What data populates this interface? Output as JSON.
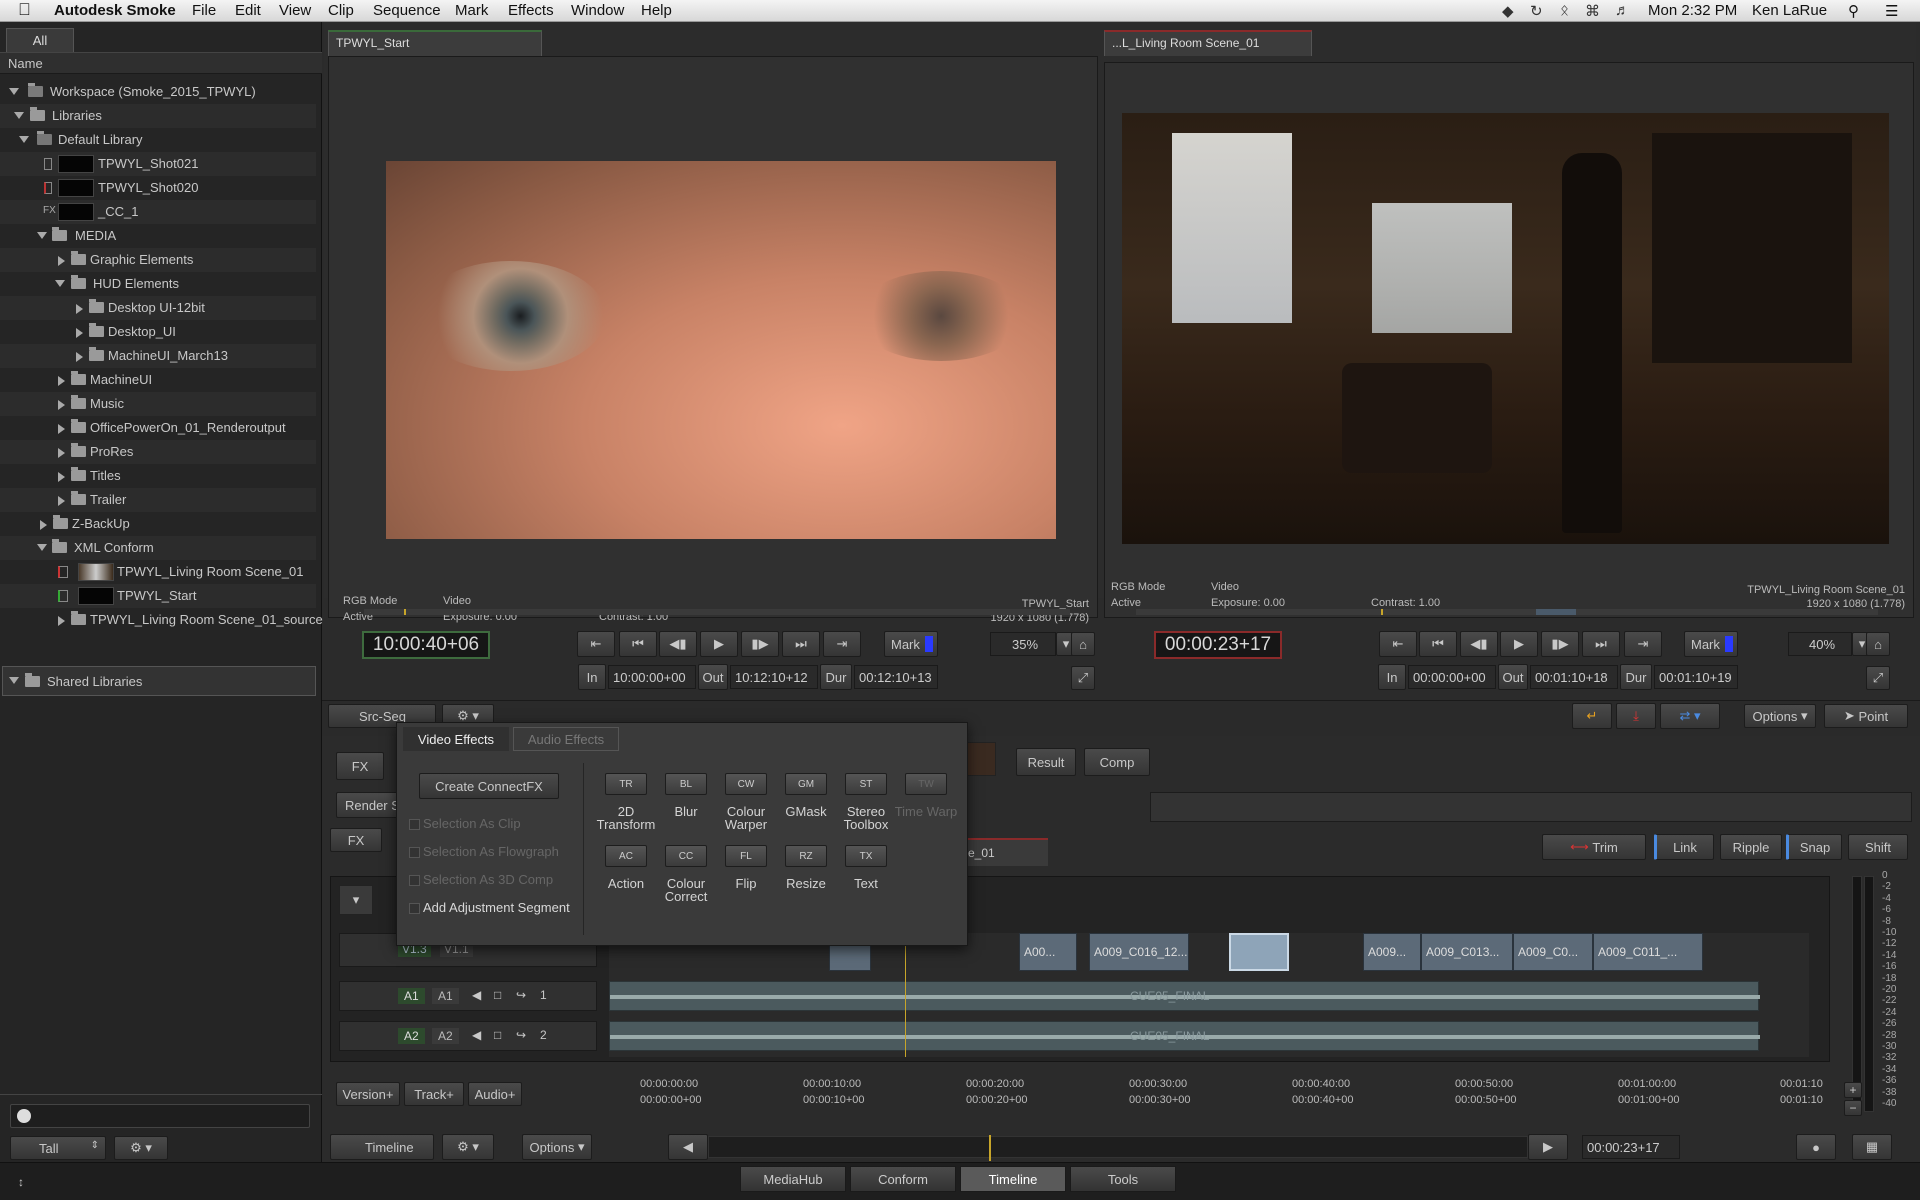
{
  "menubar": {
    "app_name": "Autodesk Smoke",
    "items": [
      "File",
      "Edit",
      "View",
      "Clip",
      "Sequence",
      "Mark",
      "Effects",
      "Window",
      "Help"
    ],
    "clock": "Mon 2:32 PM",
    "user": "Ken LaRue"
  },
  "sidebar": {
    "tab_all": "All",
    "column_name": "Name",
    "tree": {
      "workspace": "Workspace (Smoke_2015_TPWYL)",
      "libraries": "Libraries",
      "default_library": "Default Library",
      "shot021": "TPWYL_Shot021",
      "shot020": "TPWYL_Shot020",
      "cc1": "_CC_1",
      "fx_tag": "FX",
      "media": "MEDIA",
      "graphic_elements": "Graphic Elements",
      "hud_elements": "HUD Elements",
      "desktop_ui_12bit": "Desktop UI-12bit",
      "desktop_ui": "Desktop_UI",
      "machineui_march13": "MachineUI_March13",
      "machineui": "MachineUI",
      "music": "Music",
      "officepoweron": "OfficePowerOn_01_Renderoutput",
      "prores": "ProRes",
      "titles": "Titles",
      "trailer": "Trailer",
      "zbackup": "Z-BackUp",
      "xml_conform": "XML Conform",
      "living_room": "TPWYL_Living Room Scene_01",
      "tpwyl_start": "TPWYL_Start",
      "living_room_source": "TPWYL_Living Room Scene_01_source"
    },
    "shared_libraries": "Shared Libraries",
    "view_mode": "Tall"
  },
  "left_viewer": {
    "tab": "TPWYL_Start",
    "rgb_mode": "RGB Mode",
    "active": "Active",
    "video": "Video",
    "exposure": "Exposure: 0.00",
    "contrast": "Contrast: 1.00",
    "clip_name": "TPWYL_Start",
    "resolution": "1920 x 1080 (1.778)",
    "timecode": "10:00:40+06",
    "mark": "Mark",
    "zoom": "35%",
    "in_label": "In",
    "in_value": "10:00:00+00",
    "out_label": "Out",
    "out_value": "10:12:10+12",
    "dur_label": "Dur",
    "dur_value": "00:12:10+13"
  },
  "right_viewer": {
    "tab": "...L_Living Room Scene_01",
    "rgb_mode": "RGB Mode",
    "active": "Active",
    "video": "Video",
    "exposure": "Exposure: 0.00",
    "contrast": "Contrast: 1.00",
    "clip_name": "TPWYL_Living Room Scene_01",
    "resolution": "1920 x 1080 (1.778)",
    "timecode": "00:00:23+17",
    "mark": "Mark",
    "zoom": "40%",
    "in_label": "In",
    "in_value": "00:00:00+00",
    "out_label": "Out",
    "out_value": "00:01:10+18",
    "dur_label": "Dur",
    "dur_value": "00:01:10+19"
  },
  "toolbar": {
    "src_seq": "Src-Seq",
    "options": "Options",
    "point": "Point",
    "fx": "FX",
    "render": "Render S",
    "fx2": "FX",
    "result": "Result",
    "comp": "Comp",
    "seq_tab": "e_01",
    "trim": "Trim",
    "link": "Link",
    "ripple": "Ripple",
    "snap": "Snap",
    "shift": "Shift"
  },
  "effects_popup": {
    "tab_video": "Video Effects",
    "tab_audio": "Audio Effects",
    "create_connectfx": "Create ConnectFX",
    "opt_selection_as_clip": "Selection As Clip",
    "opt_selection_as_flowgraph": "Selection As Flowgraph",
    "opt_selection_as_3dcomp": "Selection As 3D Comp",
    "opt_add_adjustment": "Add Adjustment Segment",
    "effects": [
      {
        "code": "TR",
        "label": "2D Transform"
      },
      {
        "code": "BL",
        "label": "Blur"
      },
      {
        "code": "CW",
        "label": "Colour Warper"
      },
      {
        "code": "GM",
        "label": "GMask"
      },
      {
        "code": "ST",
        "label": "Stereo Toolbox"
      },
      {
        "code": "TW",
        "label": "Time Warp"
      },
      {
        "code": "AC",
        "label": "Action"
      },
      {
        "code": "CC",
        "label": "Colour Correct"
      },
      {
        "code": "FL",
        "label": "Flip"
      },
      {
        "code": "RZ",
        "label": "Resize"
      },
      {
        "code": "TX",
        "label": "Text"
      }
    ]
  },
  "timeline": {
    "tracks": {
      "v13": "V1.3",
      "v11": "V1.1",
      "a1a": "A1",
      "a1b": "A1",
      "a1n": "1",
      "a2a": "A2",
      "a2b": "A2",
      "a2n": "2"
    },
    "clips": [
      "A00...",
      "A009_C016_12...",
      "A009...",
      "A009_C013...",
      "A009_C0...",
      "A009_C011_..."
    ],
    "audio_label": "CUE05_FINAL",
    "ruler_top": [
      "00:00:00:00",
      "00:00:10:00",
      "00:00:20:00",
      "00:00:30:00",
      "00:00:40:00",
      "00:00:50:00",
      "00:01:00:00",
      "00:01:10"
    ],
    "ruler_bottom": [
      "00:00:00+00",
      "00:00:10+00",
      "00:00:20+00",
      "00:00:30+00",
      "00:00:40+00",
      "00:00:50+00",
      "00:01:00+00",
      "00:01:10"
    ],
    "version_plus": "Version+",
    "track_plus": "Track+",
    "audio_plus": "Audio+",
    "meter_scale": [
      "0",
      "-2",
      "-4",
      "-6",
      "-8",
      "-10",
      "-12",
      "-14",
      "-16",
      "-18",
      "-20",
      "-22",
      "-24",
      "-26",
      "-28",
      "-30",
      "-32",
      "-34",
      "-36",
      "-38",
      "-40"
    ]
  },
  "bottom_bar": {
    "timeline": "Timeline",
    "options": "Options",
    "timecode": "00:00:23+17",
    "tabs": [
      "MediaHub",
      "Conform",
      "Timeline",
      "Tools"
    ],
    "active_tab": "Timeline"
  }
}
